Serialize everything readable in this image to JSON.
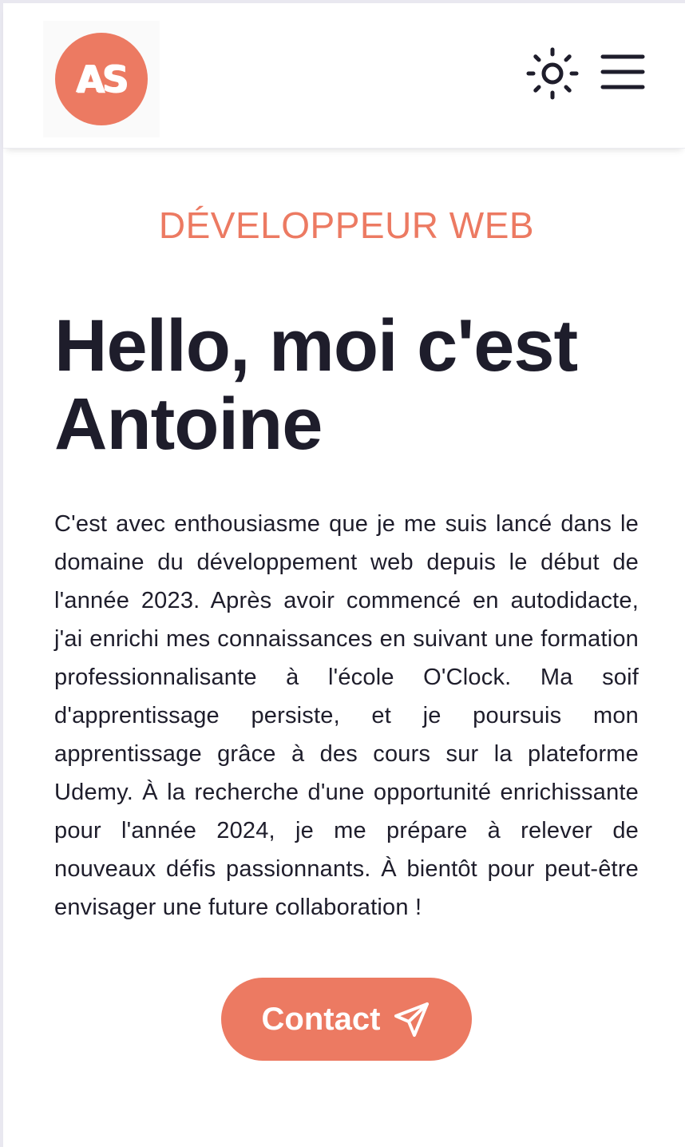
{
  "header": {
    "logo_text": "AS",
    "theme_toggle_icon": "sun-icon",
    "menu_icon": "hamburger-menu-icon"
  },
  "hero": {
    "role": "DÉVELOPPEUR WEB",
    "title_line1": "Hello, moi c'est",
    "title_line2": "Antoine",
    "intro": "C'est avec enthousiasme que je me suis lancé dans le domaine du développement web depuis le début de l'année 2023. Après avoir commencé en autodidacte, j'ai enrichi mes connaissances en suivant une formation professionnalisante à l'école O'Clock. Ma soif d'apprentissage persiste, et je poursuis mon apprentissage grâce à des cours sur la plateforme Udemy. À la recherche d'une opportunité enrichissante pour l'année 2024, je me prépare à relever de nouveaux défis passionnants. À bientôt pour peut-être envisager une future collaboration !",
    "contact_label": "Contact",
    "contact_icon": "send-icon"
  },
  "colors": {
    "accent": "#ec7a62",
    "text": "#1e1d2b",
    "background": "#ffffff"
  }
}
